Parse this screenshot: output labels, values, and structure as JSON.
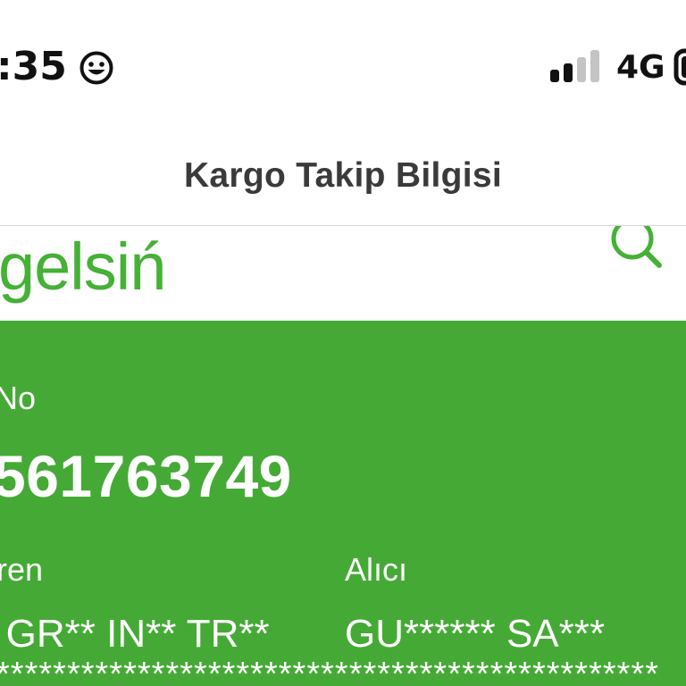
{
  "status_bar": {
    "time": ":35",
    "network": "4G",
    "signal_bars_filled": 2,
    "signal_bars_total": 4
  },
  "nav": {
    "title": "Kargo Takip Bilgisi"
  },
  "header": {
    "logo_text": "gelsiń",
    "brand_color": "#46b037"
  },
  "tracking": {
    "number_label": "No",
    "number": "561763749",
    "sender_label": "ren",
    "sender_value": "' GR** IN** TR**",
    "receiver_label": "Alıcı",
    "receiver_value": "GU****** SA***",
    "masked_line": "***********************************************",
    "panel_color": "#45aa35"
  },
  "icons": [
    "smiley-icon",
    "signal-icon",
    "battery-icon",
    "search-icon"
  ]
}
